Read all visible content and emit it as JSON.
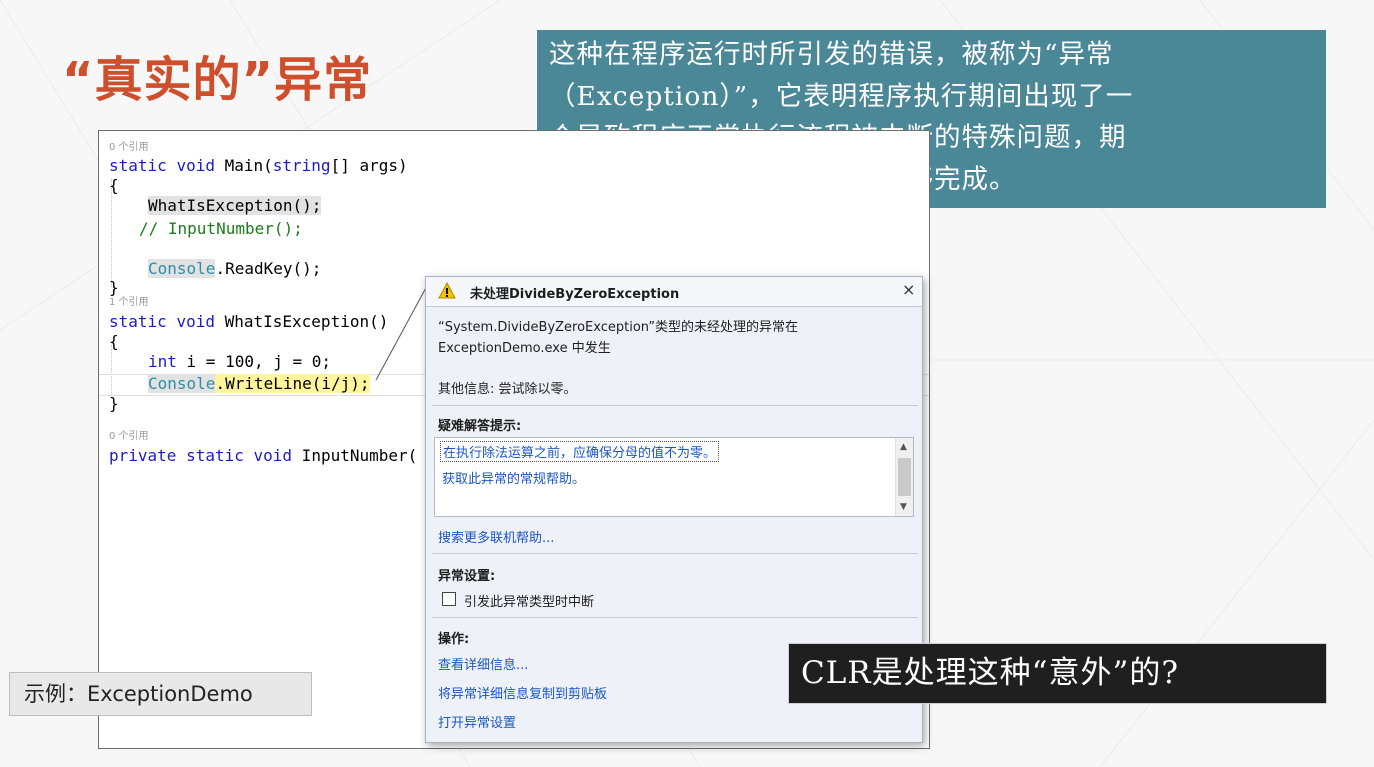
{
  "slide": {
    "title": "“真实的”异常",
    "definition_lines": [
      "这种在程序运行时所引发的错误，被称为“异常",
      "（Exception）”，它表明程序执行期间出现了一",
      "个导致程序正常执行流程被中断的特殊问题，期",
      "望程序进行的某项操作没有能够完成。"
    ],
    "example_label": "示例：ExceptionDemo",
    "question": "CLR是处理这种“意外”的?"
  },
  "code": {
    "ref_hint_main": "0 个引用",
    "ref_hint_what": "1 个引用",
    "ref_hint_input": "0 个引用",
    "kw_static": "static",
    "kw_void": "void",
    "kw_string": "string",
    "kw_int": "int",
    "kw_private": "private",
    "main_name": " Main(",
    "main_args": "[] args)",
    "open_brace": "{",
    "close_brace": "}",
    "call_what": "WhatIsException();",
    "comment_input": "// InputNumber();",
    "console_type": "Console",
    "readkey_call": ".ReadKey();",
    "what_name": " WhatIsException()",
    "int_decl": " i = 100, j = 0;",
    "writeline_call": ".WriteLine(i/j);",
    "input_name": " InputNumber("
  },
  "dialog": {
    "title": "未处理DivideByZeroException",
    "close_glyph": "×",
    "message": "“System.DivideByZeroException”类型的未经处理的异常在 ExceptionDemo.exe 中发生",
    "extra_info": "其他信息: 尝试除以零。",
    "tips_heading": "疑难解答提示:",
    "tips": [
      "在执行除法运算之前，应确保分母的值不为零。",
      "获取此异常的常规帮助。"
    ],
    "scroll_up_glyph": "▲",
    "scroll_down_glyph": "▼",
    "search_link": "搜索更多联机帮助...",
    "settings_heading": "异常设置:",
    "break_checkbox_label": "引发此异常类型时中断",
    "break_checkbox_checked": false,
    "actions_heading": "操作:",
    "actions": [
      "查看详细信息...",
      "将异常详细信息复制到剪贴板",
      "打开异常设置"
    ]
  },
  "icons": {
    "dialog_icon": "warning-icon"
  },
  "colors": {
    "title": "#cf4f2c",
    "info_box": "#4a8797",
    "keyword": "#1c1cc7",
    "comment": "#1e7b1e",
    "type": "#2b8fa8",
    "link": "#1a56c4",
    "question_box": "#1f1f1f"
  }
}
